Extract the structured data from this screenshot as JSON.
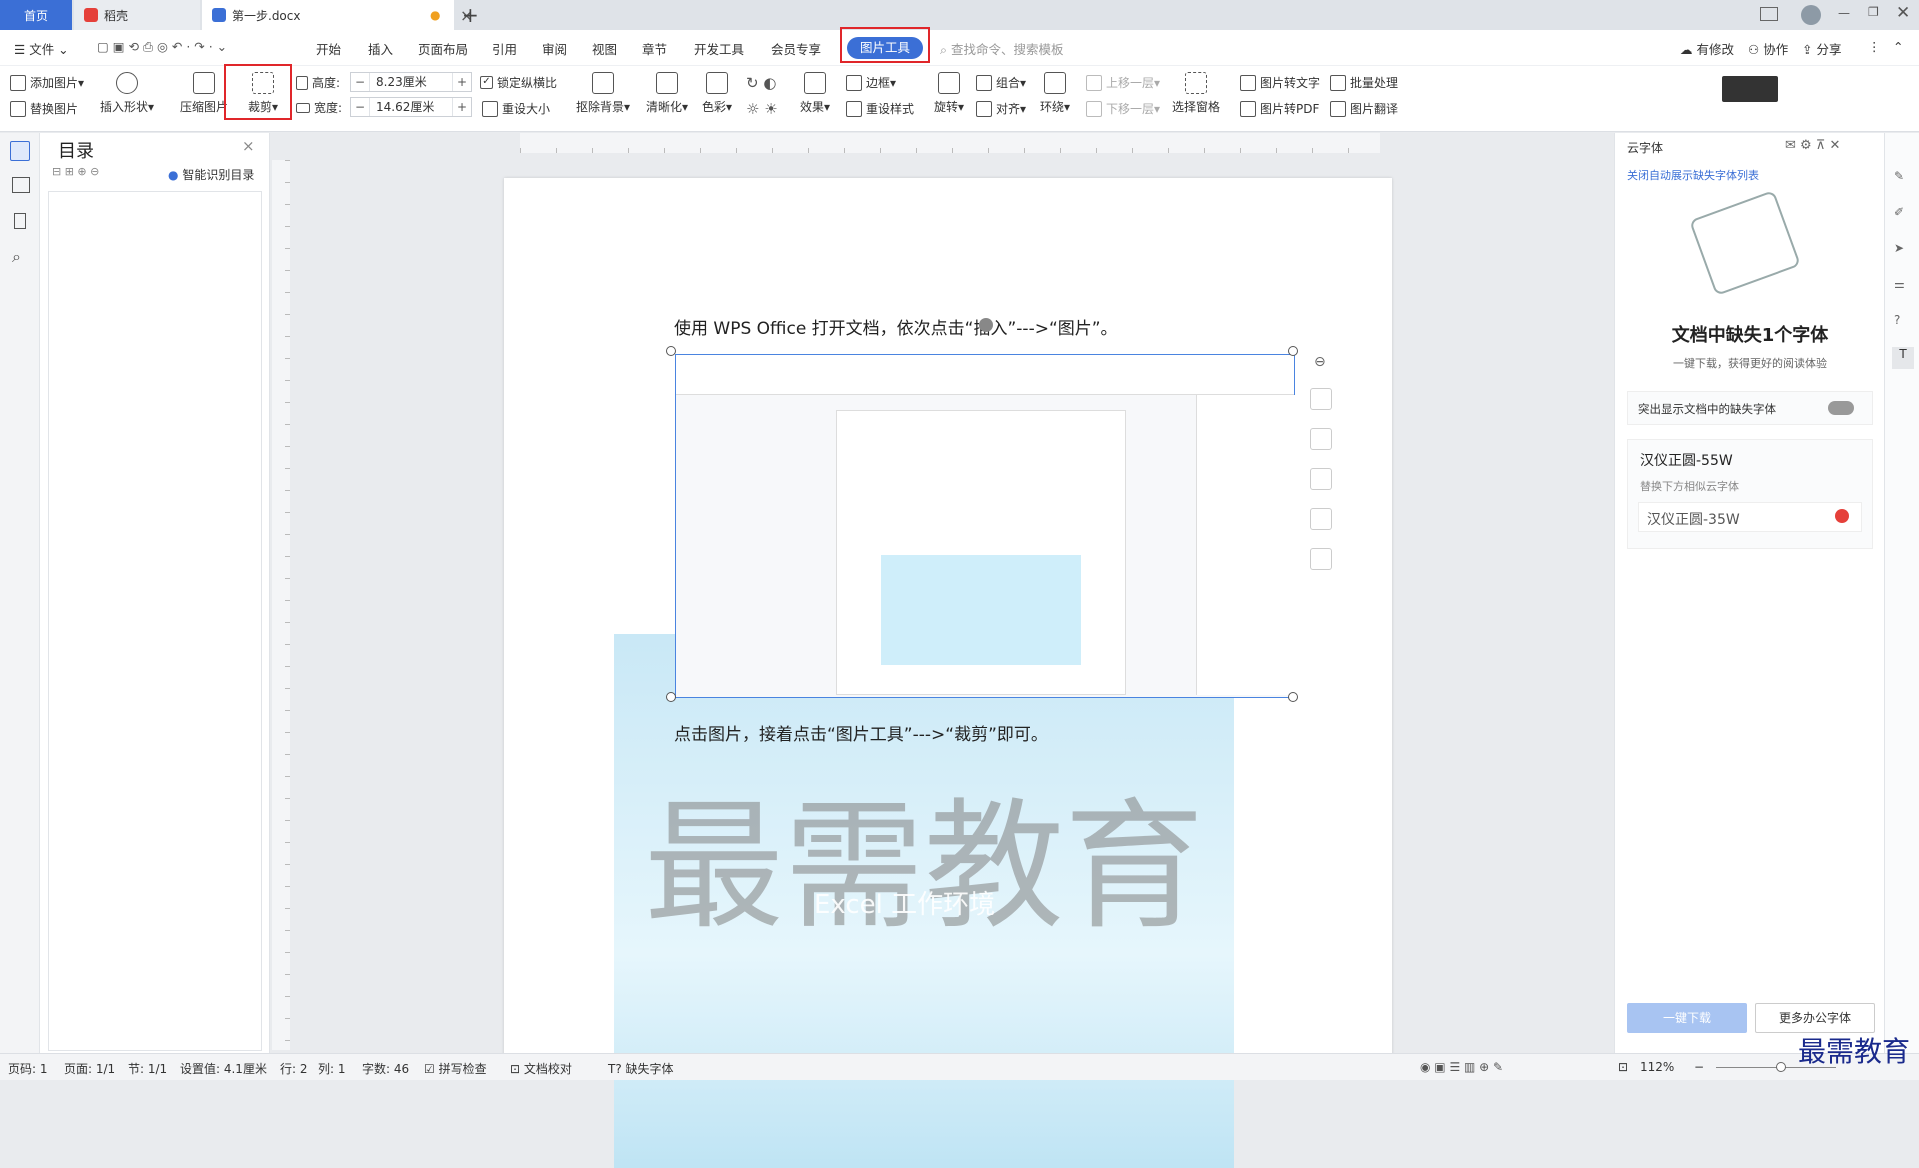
{
  "tabs": {
    "home": "首页",
    "daoke": "稻壳",
    "doc": "第一步.docx",
    "add": "+"
  },
  "menu": {
    "file": "文件",
    "items": [
      "开始",
      "插入",
      "页面布局",
      "引用",
      "审阅",
      "视图",
      "章节",
      "开发工具",
      "会员专享"
    ],
    "active": "图片工具",
    "search": "查找命令、搜索模板",
    "changed": "有修改",
    "collab": "协作",
    "share": "分享"
  },
  "ribbon": {
    "add_pic": "添加图片",
    "replace_pic": "替换图片",
    "insert_shape": "插入形状",
    "compress": "压缩图片",
    "crop": "裁剪",
    "height_label": "高度:",
    "height_val": "8.23厘米",
    "width_label": "宽度:",
    "width_val": "14.62厘米",
    "lock_ratio": "锁定纵横比",
    "reset_size": "重设大小",
    "remove_bg": "抠除背景",
    "sharpen": "清晰化",
    "color": "色彩",
    "effect": "效果",
    "border": "边框",
    "reset_style": "重设样式",
    "rotate": "旋转",
    "group": "组合",
    "align": "对齐",
    "wrap": "环绕",
    "up_layer": "上移一层",
    "down_layer": "下移一层",
    "select_pane": "选择窗格",
    "pic_to_text": "图片转文字",
    "pic_to_pdf": "图片转PDF",
    "batch": "批量处理",
    "translate": "图片翻译"
  },
  "nav": {
    "title": "目录",
    "smart": "智能识别目录"
  },
  "doc": {
    "line1": "使用 WPS Office 打开文档，依次点击“插入”--->“图片”。",
    "line2": "点击图片，接着点击“图片工具”--->“裁剪”即可。",
    "watermark": "最需教育",
    "watermark2": "Excel 工作环境"
  },
  "rpanel": {
    "header": "云字体",
    "link": "关闭自动展示缺失字体列表",
    "title": "文档中缺失1个字体",
    "sub": "一键下载，获得更好的阅读体验",
    "toggle_label": "突出显示文档中的缺失字体",
    "font_missing": "汉仪正圆-55W",
    "replace_hint": "替换下方相似云字体",
    "font_similar": "汉仪正圆-35W",
    "download": "一键下载",
    "more": "更多办公字体"
  },
  "status": {
    "page": "页码: 1",
    "pages": "页面: 1/1",
    "section": "节: 1/1",
    "setting": "设置值: 4.1厘米",
    "row": "行: 2",
    "col": "列: 1",
    "words": "字数: 46",
    "spell": "拼写检查",
    "proof": "文档校对",
    "missing_font": "缺失字体",
    "zoom": "112%"
  },
  "brand": "最需教育",
  "colors": {
    "accent": "#3b6fd6",
    "highlight": "#e0262a"
  }
}
